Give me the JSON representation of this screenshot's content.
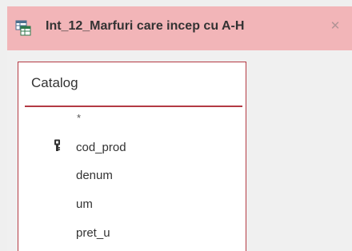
{
  "tab": {
    "title": "Int_12_Marfuri care incep cu A-H",
    "close_glyph": "✕",
    "icon": "query-icon"
  },
  "table": {
    "name": "Catalog",
    "fields": [
      {
        "label": "*",
        "is_key": false
      },
      {
        "label": "cod_prod",
        "is_key": true
      },
      {
        "label": "denum",
        "is_key": false
      },
      {
        "label": "um",
        "is_key": false
      },
      {
        "label": "pret_u",
        "is_key": false
      }
    ]
  },
  "colors": {
    "tab_background": "#f2b5b8",
    "table_border": "#b33a44",
    "canvas": "#f0f0f0"
  }
}
